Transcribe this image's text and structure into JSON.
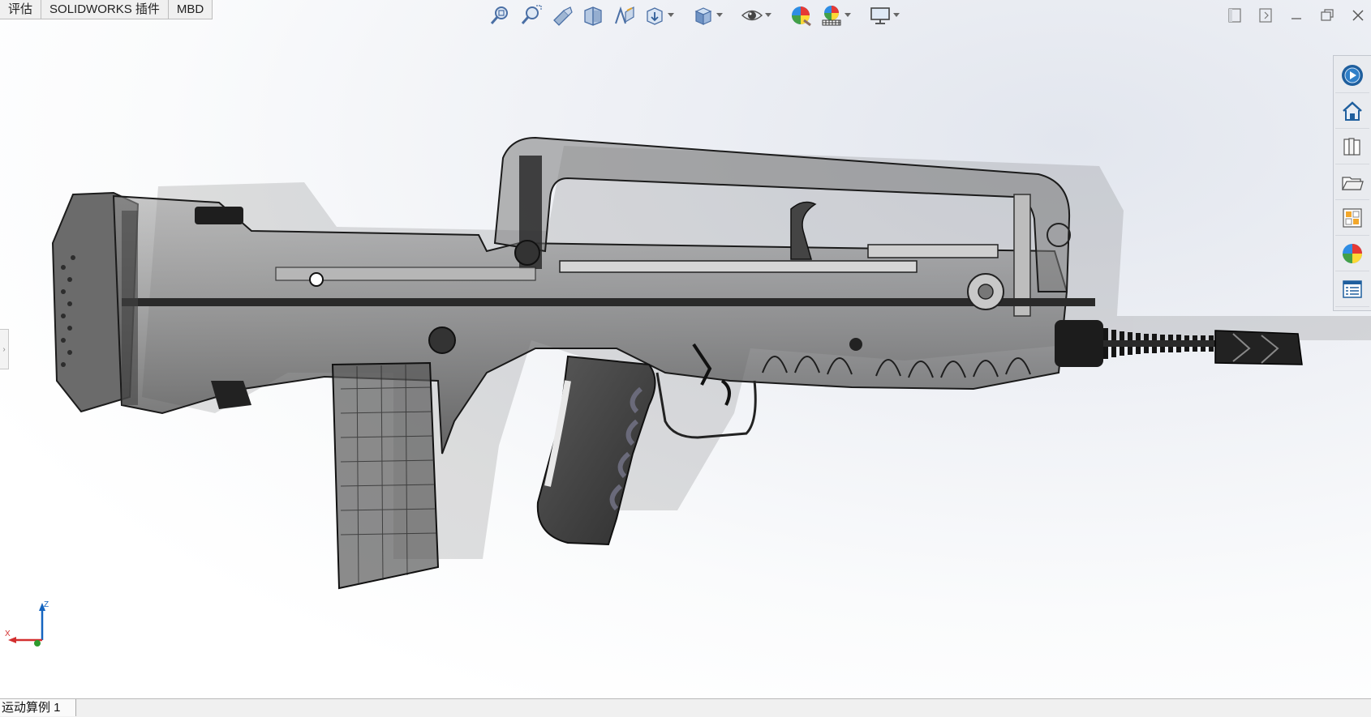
{
  "window": {
    "tabs": [
      "评估",
      "SOLIDWORKS 插件",
      "MBD"
    ]
  },
  "headsup_toolbar": {
    "icons": [
      "zoom-to-fit-icon",
      "zoom-to-area-icon",
      "previous-view-icon",
      "section-view-icon",
      "dynamic-annotation-view-icon",
      "view-orientation-icon",
      "display-style-icon",
      "hide-show-items-icon",
      "edit-appearance-icon",
      "apply-scene-icon",
      "view-settings-icon"
    ]
  },
  "window_controls": {
    "icons": [
      "tile-left-icon",
      "tile-right-icon",
      "minimize-icon",
      "restore-icon",
      "close-icon"
    ]
  },
  "task_pane": {
    "icons": [
      "solidworks-resources-icon",
      "home-icon",
      "design-library-icon",
      "file-explorer-icon",
      "view-palette-icon",
      "appearances-scenes-icon",
      "custom-properties-icon"
    ]
  },
  "triad": {
    "z_label": "Z",
    "x_label": "X"
  },
  "status_bar": {
    "motion_study_tab": "运动算例 1"
  },
  "colors": {
    "viewport_tint": "#e2e6ee",
    "tab_bg": "#f0f0f0",
    "axis_x": "#d32f2f",
    "axis_y": "#2e9b2e",
    "axis_z": "#1565c0"
  }
}
